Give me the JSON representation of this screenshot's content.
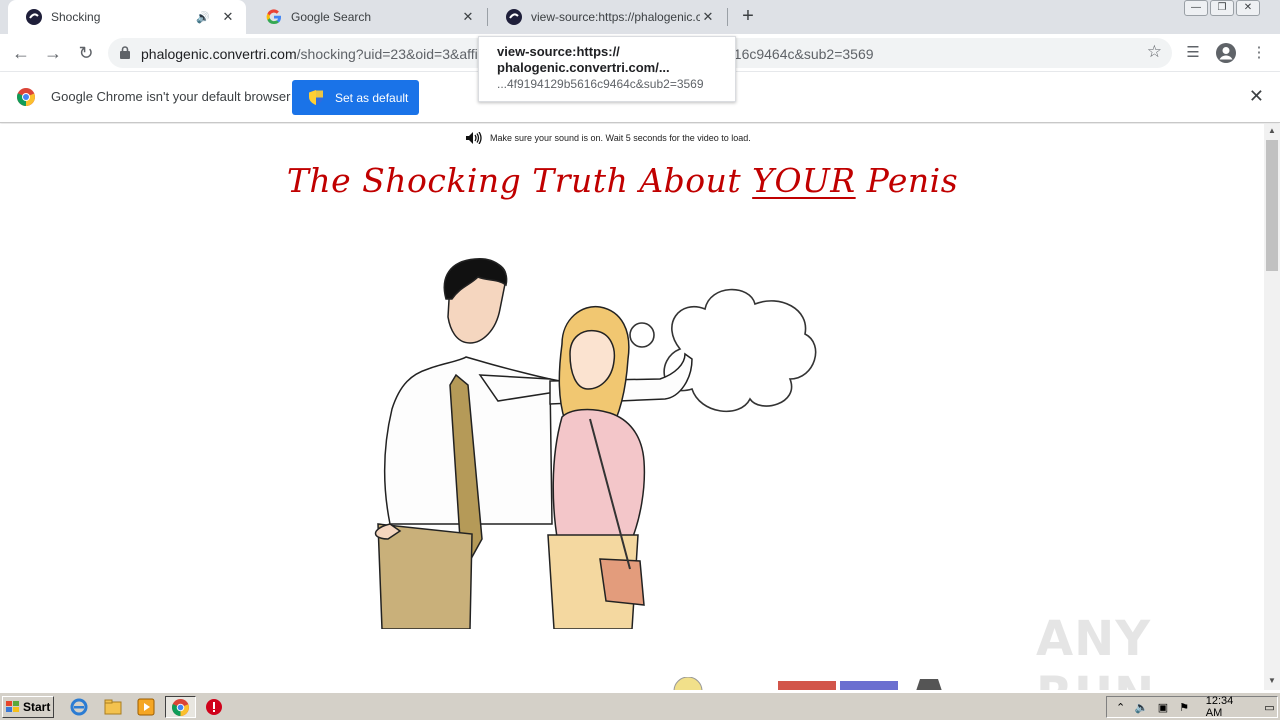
{
  "browser": {
    "tabs": [
      {
        "title": "Shocking",
        "favicon": "convertri-icon",
        "active": true,
        "audio": true
      },
      {
        "title": "Google Search",
        "favicon": "google-g-icon",
        "active": false
      },
      {
        "title": "view-source:https://phalogenic.conv",
        "favicon": "convertri-icon",
        "active": false
      }
    ],
    "new_tab_label": "+",
    "address": {
      "host": "phalogenic.convertri.com",
      "path": "/shocking?uid=23&oid=3&affi",
      "tail": "516c9464c&sub2=3569"
    },
    "tooltip": {
      "line1": "view-source:https://",
      "line2": "phalogenic.convertri.com/...",
      "line3": "...4f9194129b5616c9464c&sub2=3569"
    },
    "infobar": {
      "message": "Google Chrome isn't your default browser",
      "button_label": "Set as default"
    }
  },
  "page": {
    "sound_note": "Make sure your sound is on. Wait 5 seconds for the video to load.",
    "headline_before": "The Shocking Truth About ",
    "headline_emphasis": "YOUR",
    "headline_after": " Penis",
    "watermark": "ANY RUN"
  },
  "taskbar": {
    "start_label": "Start",
    "clock": "12:34 AM"
  },
  "colors": {
    "headline": "#c00000",
    "chrome_blue": "#1a73e8",
    "tabstrip": "#dee1e6",
    "taskbar": "#d4d0c8"
  }
}
